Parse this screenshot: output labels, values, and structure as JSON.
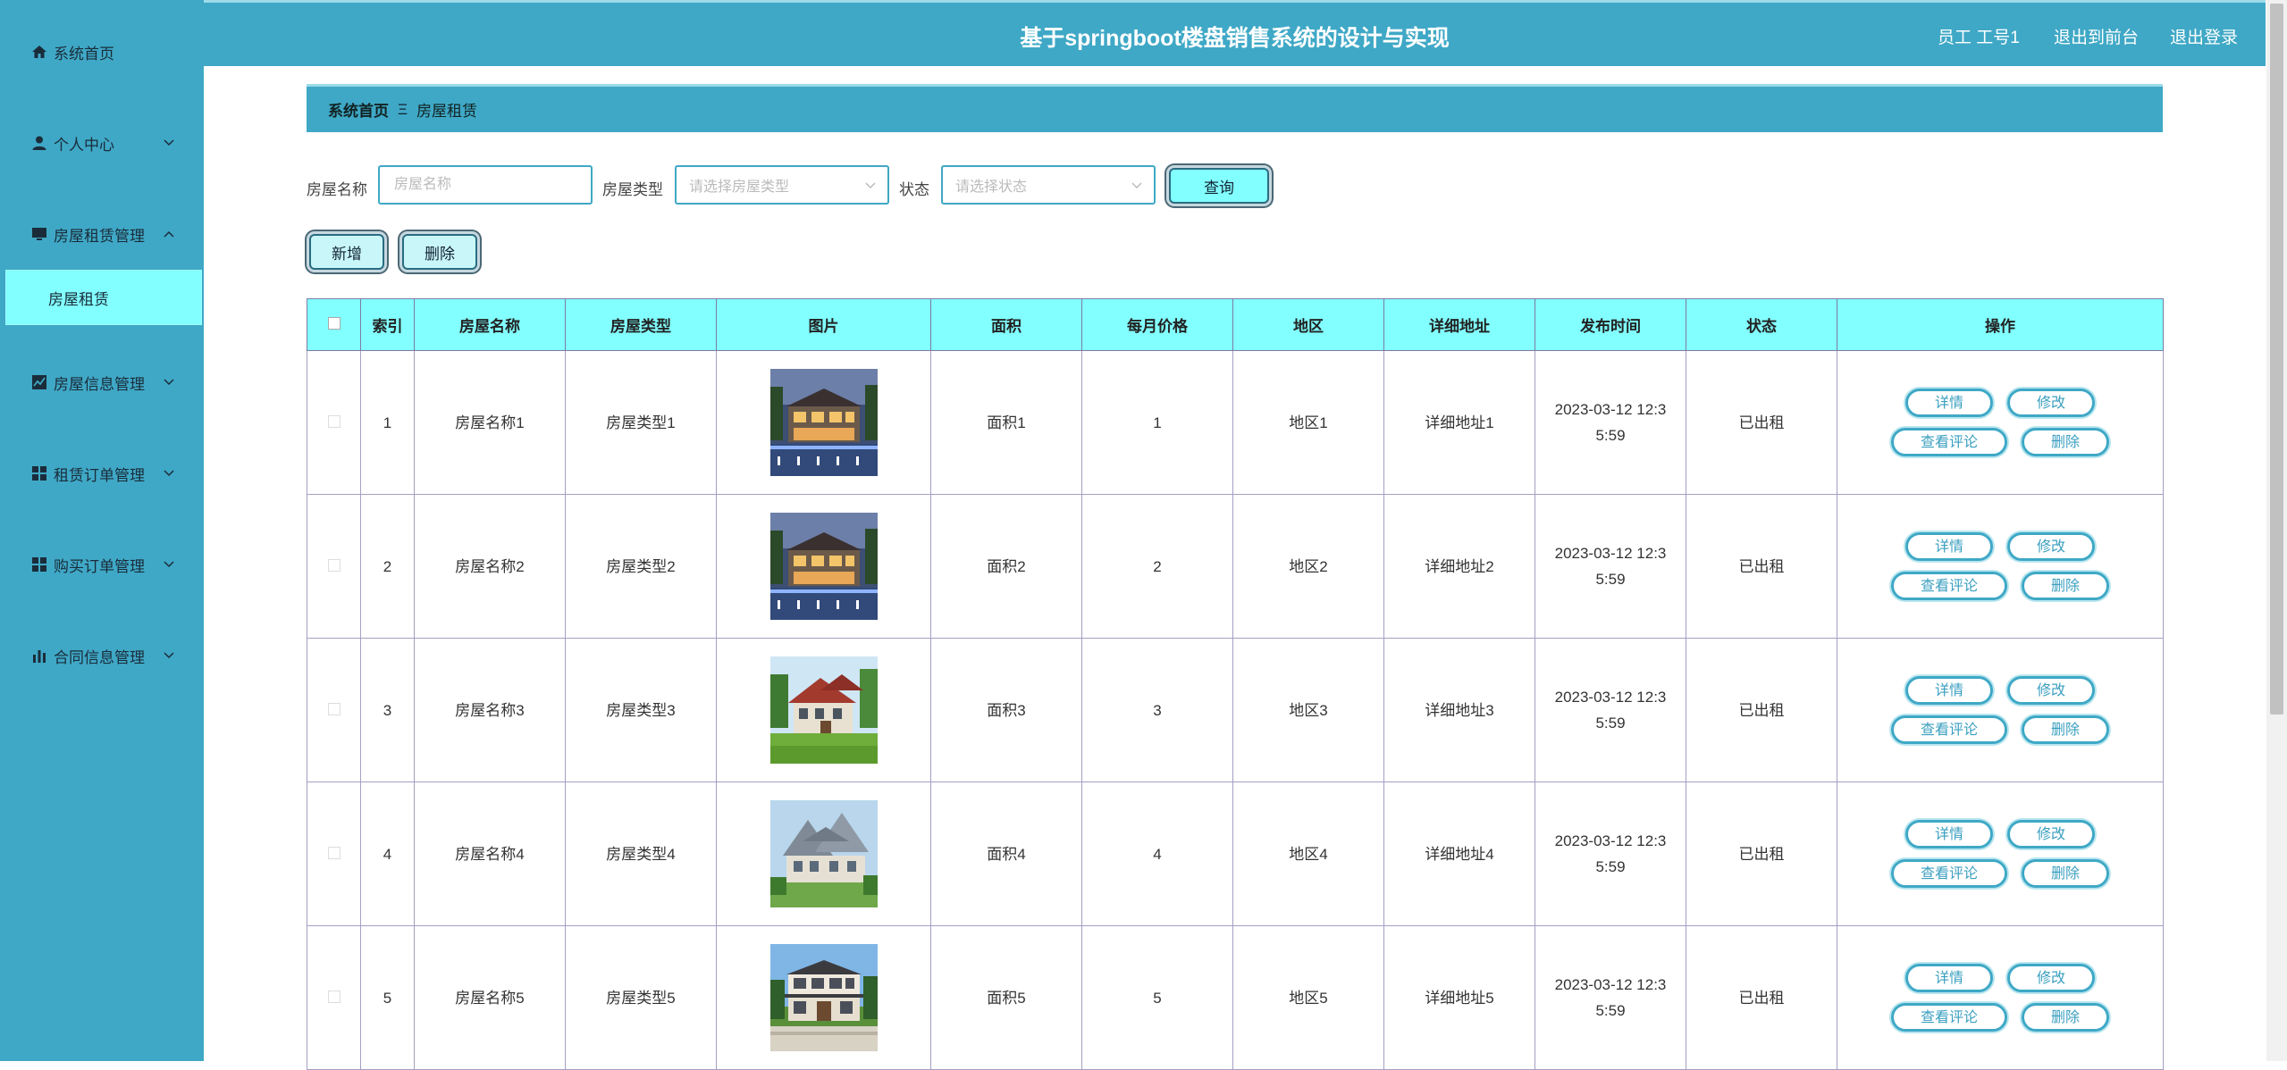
{
  "app": {
    "title": "基于springboot楼盘销售系统的设计与实现",
    "user_label": "员工 工号1",
    "front_link": "退出到前台",
    "logout_link": "退出登录"
  },
  "sidebar": {
    "items": [
      {
        "label": "系统首页",
        "icon": "home-icon",
        "chevron": ""
      },
      {
        "label": "个人中心",
        "icon": "user-icon",
        "chevron": "down"
      },
      {
        "label": "房屋租赁管理",
        "icon": "monitor-icon",
        "chevron": "up"
      },
      {
        "label": "房屋信息管理",
        "icon": "chart-icon",
        "chevron": "down"
      },
      {
        "label": "租赁订单管理",
        "icon": "grid-icon",
        "chevron": "down"
      },
      {
        "label": "购买订单管理",
        "icon": "grid-icon",
        "chevron": "down"
      },
      {
        "label": "合同信息管理",
        "icon": "bar-chart-icon",
        "chevron": "down"
      }
    ],
    "active_sub": "房屋租赁"
  },
  "breadcrumb": {
    "home": "系统首页",
    "separator": "Ξ",
    "current": "房屋租赁"
  },
  "search": {
    "name_label": "房屋名称",
    "name_placeholder": "房屋名称",
    "type_label": "房屋类型",
    "type_placeholder": "请选择房屋类型",
    "status_label": "状态",
    "status_placeholder": "请选择状态",
    "query_button": "查询"
  },
  "actions": {
    "add": "新增",
    "delete": "删除"
  },
  "table": {
    "headers": [
      "索引",
      "房屋名称",
      "房屋类型",
      "图片",
      "面积",
      "每月价格",
      "地区",
      "详细地址",
      "发布时间",
      "状态",
      "操作"
    ],
    "row_buttons": {
      "detail": "详情",
      "edit": "修改",
      "comments": "查看评论",
      "delete": "删除"
    },
    "rows": [
      {
        "index": "1",
        "name": "房屋名称1",
        "type": "房屋类型1",
        "image": "villa-night",
        "area": "面积1",
        "price": "1",
        "region": "地区1",
        "address": "详细地址1",
        "time": "2023-03-12 12:35:59",
        "status": "已出租"
      },
      {
        "index": "2",
        "name": "房屋名称2",
        "type": "房屋类型2",
        "image": "villa-night",
        "area": "面积2",
        "price": "2",
        "region": "地区2",
        "address": "详细地址2",
        "time": "2023-03-12 12:35:59",
        "status": "已出租"
      },
      {
        "index": "3",
        "name": "房屋名称3",
        "type": "房屋类型3",
        "image": "cottage-red-roof",
        "area": "面积3",
        "price": "3",
        "region": "地区3",
        "address": "详细地址3",
        "time": "2023-03-12 12:35:59",
        "status": "已出租"
      },
      {
        "index": "4",
        "name": "房屋名称4",
        "type": "房屋类型4",
        "image": "villa-grey-roof",
        "area": "面积4",
        "price": "4",
        "region": "地区4",
        "address": "详细地址4",
        "time": "2023-03-12 12:35:59",
        "status": "已出租"
      },
      {
        "index": "5",
        "name": "房屋名称5",
        "type": "房屋类型5",
        "image": "villa-two-storey",
        "area": "面积5",
        "price": "5",
        "region": "地区5",
        "address": "详细地址5",
        "time": "2023-03-12 12:35:59",
        "status": "已出租"
      }
    ]
  },
  "colors": {
    "primary": "#3fa8c6",
    "accent": "#82ffff",
    "border": "#a49fc4"
  }
}
